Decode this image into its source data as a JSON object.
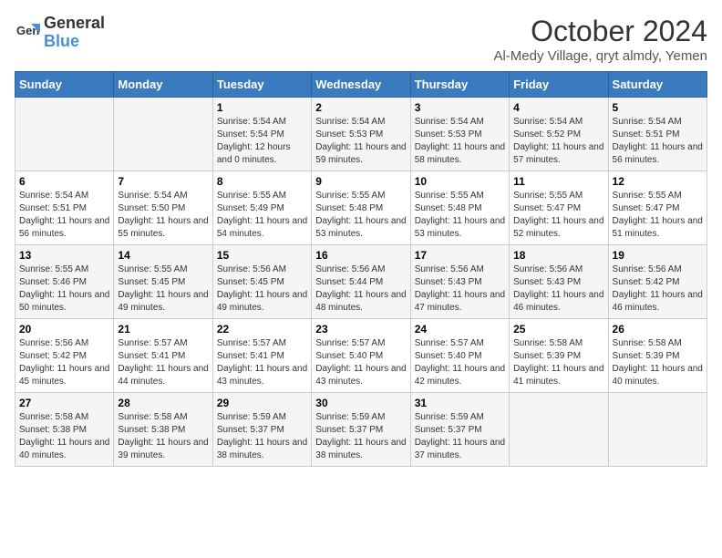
{
  "logo": {
    "general": "General",
    "blue": "Blue"
  },
  "title": "October 2024",
  "location": "Al-Medy Village, qryt almdy, Yemen",
  "days_header": [
    "Sunday",
    "Monday",
    "Tuesday",
    "Wednesday",
    "Thursday",
    "Friday",
    "Saturday"
  ],
  "weeks": [
    [
      {
        "day": "",
        "sunrise": "",
        "sunset": "",
        "daylight": ""
      },
      {
        "day": "",
        "sunrise": "",
        "sunset": "",
        "daylight": ""
      },
      {
        "day": "1",
        "sunrise": "Sunrise: 5:54 AM",
        "sunset": "Sunset: 5:54 PM",
        "daylight": "Daylight: 12 hours and 0 minutes."
      },
      {
        "day": "2",
        "sunrise": "Sunrise: 5:54 AM",
        "sunset": "Sunset: 5:53 PM",
        "daylight": "Daylight: 11 hours and 59 minutes."
      },
      {
        "day": "3",
        "sunrise": "Sunrise: 5:54 AM",
        "sunset": "Sunset: 5:53 PM",
        "daylight": "Daylight: 11 hours and 58 minutes."
      },
      {
        "day": "4",
        "sunrise": "Sunrise: 5:54 AM",
        "sunset": "Sunset: 5:52 PM",
        "daylight": "Daylight: 11 hours and 57 minutes."
      },
      {
        "day": "5",
        "sunrise": "Sunrise: 5:54 AM",
        "sunset": "Sunset: 5:51 PM",
        "daylight": "Daylight: 11 hours and 56 minutes."
      }
    ],
    [
      {
        "day": "6",
        "sunrise": "Sunrise: 5:54 AM",
        "sunset": "Sunset: 5:51 PM",
        "daylight": "Daylight: 11 hours and 56 minutes."
      },
      {
        "day": "7",
        "sunrise": "Sunrise: 5:54 AM",
        "sunset": "Sunset: 5:50 PM",
        "daylight": "Daylight: 11 hours and 55 minutes."
      },
      {
        "day": "8",
        "sunrise": "Sunrise: 5:55 AM",
        "sunset": "Sunset: 5:49 PM",
        "daylight": "Daylight: 11 hours and 54 minutes."
      },
      {
        "day": "9",
        "sunrise": "Sunrise: 5:55 AM",
        "sunset": "Sunset: 5:48 PM",
        "daylight": "Daylight: 11 hours and 53 minutes."
      },
      {
        "day": "10",
        "sunrise": "Sunrise: 5:55 AM",
        "sunset": "Sunset: 5:48 PM",
        "daylight": "Daylight: 11 hours and 53 minutes."
      },
      {
        "day": "11",
        "sunrise": "Sunrise: 5:55 AM",
        "sunset": "Sunset: 5:47 PM",
        "daylight": "Daylight: 11 hours and 52 minutes."
      },
      {
        "day": "12",
        "sunrise": "Sunrise: 5:55 AM",
        "sunset": "Sunset: 5:47 PM",
        "daylight": "Daylight: 11 hours and 51 minutes."
      }
    ],
    [
      {
        "day": "13",
        "sunrise": "Sunrise: 5:55 AM",
        "sunset": "Sunset: 5:46 PM",
        "daylight": "Daylight: 11 hours and 50 minutes."
      },
      {
        "day": "14",
        "sunrise": "Sunrise: 5:55 AM",
        "sunset": "Sunset: 5:45 PM",
        "daylight": "Daylight: 11 hours and 49 minutes."
      },
      {
        "day": "15",
        "sunrise": "Sunrise: 5:56 AM",
        "sunset": "Sunset: 5:45 PM",
        "daylight": "Daylight: 11 hours and 49 minutes."
      },
      {
        "day": "16",
        "sunrise": "Sunrise: 5:56 AM",
        "sunset": "Sunset: 5:44 PM",
        "daylight": "Daylight: 11 hours and 48 minutes."
      },
      {
        "day": "17",
        "sunrise": "Sunrise: 5:56 AM",
        "sunset": "Sunset: 5:43 PM",
        "daylight": "Daylight: 11 hours and 47 minutes."
      },
      {
        "day": "18",
        "sunrise": "Sunrise: 5:56 AM",
        "sunset": "Sunset: 5:43 PM",
        "daylight": "Daylight: 11 hours and 46 minutes."
      },
      {
        "day": "19",
        "sunrise": "Sunrise: 5:56 AM",
        "sunset": "Sunset: 5:42 PM",
        "daylight": "Daylight: 11 hours and 46 minutes."
      }
    ],
    [
      {
        "day": "20",
        "sunrise": "Sunrise: 5:56 AM",
        "sunset": "Sunset: 5:42 PM",
        "daylight": "Daylight: 11 hours and 45 minutes."
      },
      {
        "day": "21",
        "sunrise": "Sunrise: 5:57 AM",
        "sunset": "Sunset: 5:41 PM",
        "daylight": "Daylight: 11 hours and 44 minutes."
      },
      {
        "day": "22",
        "sunrise": "Sunrise: 5:57 AM",
        "sunset": "Sunset: 5:41 PM",
        "daylight": "Daylight: 11 hours and 43 minutes."
      },
      {
        "day": "23",
        "sunrise": "Sunrise: 5:57 AM",
        "sunset": "Sunset: 5:40 PM",
        "daylight": "Daylight: 11 hours and 43 minutes."
      },
      {
        "day": "24",
        "sunrise": "Sunrise: 5:57 AM",
        "sunset": "Sunset: 5:40 PM",
        "daylight": "Daylight: 11 hours and 42 minutes."
      },
      {
        "day": "25",
        "sunrise": "Sunrise: 5:58 AM",
        "sunset": "Sunset: 5:39 PM",
        "daylight": "Daylight: 11 hours and 41 minutes."
      },
      {
        "day": "26",
        "sunrise": "Sunrise: 5:58 AM",
        "sunset": "Sunset: 5:39 PM",
        "daylight": "Daylight: 11 hours and 40 minutes."
      }
    ],
    [
      {
        "day": "27",
        "sunrise": "Sunrise: 5:58 AM",
        "sunset": "Sunset: 5:38 PM",
        "daylight": "Daylight: 11 hours and 40 minutes."
      },
      {
        "day": "28",
        "sunrise": "Sunrise: 5:58 AM",
        "sunset": "Sunset: 5:38 PM",
        "daylight": "Daylight: 11 hours and 39 minutes."
      },
      {
        "day": "29",
        "sunrise": "Sunrise: 5:59 AM",
        "sunset": "Sunset: 5:37 PM",
        "daylight": "Daylight: 11 hours and 38 minutes."
      },
      {
        "day": "30",
        "sunrise": "Sunrise: 5:59 AM",
        "sunset": "Sunset: 5:37 PM",
        "daylight": "Daylight: 11 hours and 38 minutes."
      },
      {
        "day": "31",
        "sunrise": "Sunrise: 5:59 AM",
        "sunset": "Sunset: 5:37 PM",
        "daylight": "Daylight: 11 hours and 37 minutes."
      },
      {
        "day": "",
        "sunrise": "",
        "sunset": "",
        "daylight": ""
      },
      {
        "day": "",
        "sunrise": "",
        "sunset": "",
        "daylight": ""
      }
    ]
  ]
}
